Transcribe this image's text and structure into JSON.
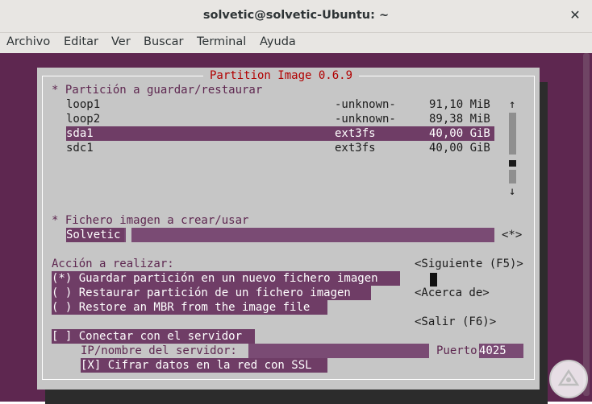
{
  "window": {
    "title": "solvetic@solvetic-Ubuntu: ~"
  },
  "menu": [
    "Archivo",
    "Editar",
    "Ver",
    "Buscar",
    "Terminal",
    "Ayuda"
  ],
  "dialog": {
    "title": "Partition Image 0.6.9",
    "partition_label": "* Partición a guardar/restaurar",
    "partitions": [
      {
        "name": "loop1",
        "fs": "-unknown-",
        "size": "91,10 MiB"
      },
      {
        "name": "loop2",
        "fs": "-unknown-",
        "size": "89,38 MiB"
      },
      {
        "name": "sda1",
        "fs": "ext3fs",
        "size": "40,00 GiB"
      },
      {
        "name": "sdc1",
        "fs": "ext3fs",
        "size": "40,00 GiB"
      }
    ],
    "selected_partition": 2,
    "scroll_up": "↑",
    "scroll_down": "↓",
    "image_label": "* Fichero imagen a crear/usar",
    "image_value": "Solvetic",
    "image_browse": "<*>",
    "action_label": "Acción a realizar:",
    "actions": [
      "(*) Guardar partición en un nuevo fichero imagen",
      "( ) Restaurar partición de un fichero imagen",
      "( ) Restore an MBR from the image file"
    ],
    "btn_next": "<Siguiente (F5)>",
    "btn_about": "<Acerca de>",
    "btn_exit": "<Salir (F6)>",
    "server_checkbox": "[ ] Conectar con el servidor",
    "server_ip_label": "IP/nombre del servidor:",
    "port_label": "Puerto",
    "port_value": "4025",
    "ssl_checkbox": "[X] Cifrar datos en la red con SSL"
  }
}
